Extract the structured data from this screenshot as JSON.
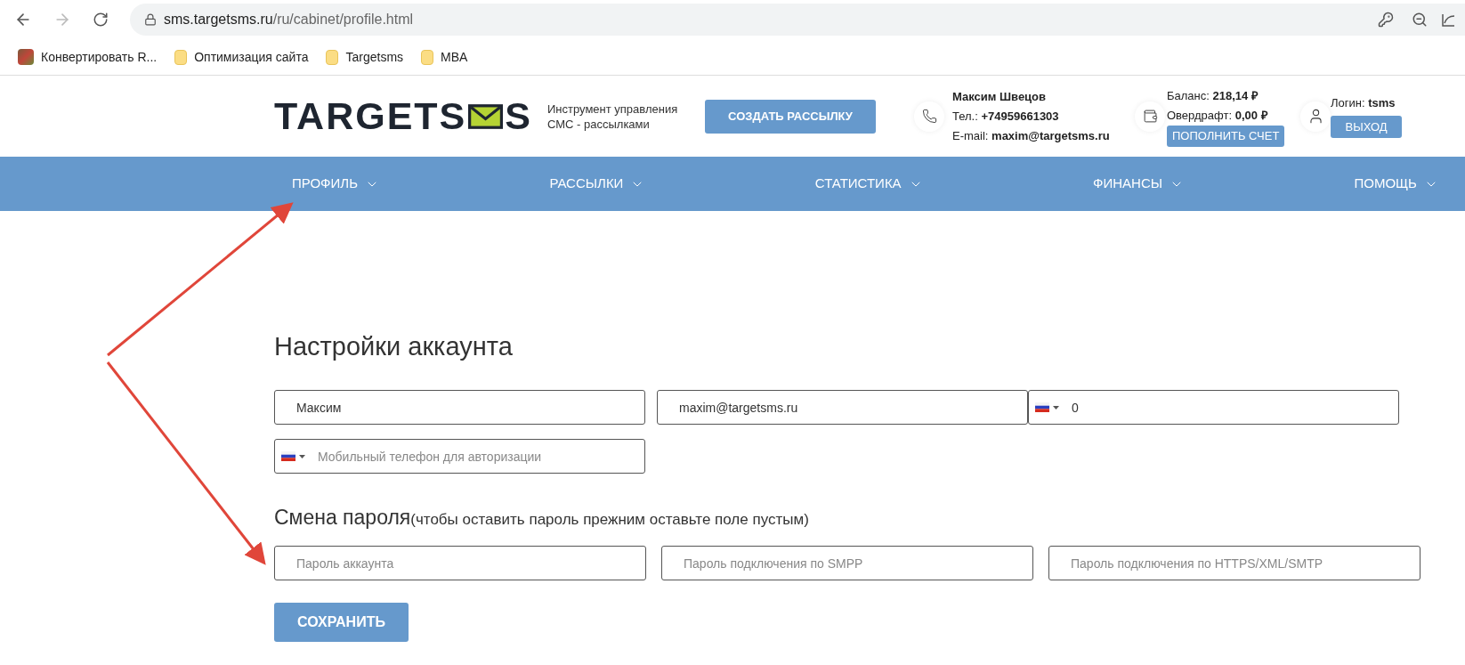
{
  "browser": {
    "url_host": "sms.targetsms.ru",
    "url_path": "/ru/cabinet/profile.html",
    "bookmarks": [
      {
        "label": "Конвертировать R...",
        "kind": "site"
      },
      {
        "label": "Оптимизация сайта",
        "kind": "folder"
      },
      {
        "label": "Targetsms",
        "kind": "folder"
      },
      {
        "label": "MBA",
        "kind": "folder"
      }
    ]
  },
  "header": {
    "logo_left": "TARGETS",
    "logo_right": "S",
    "tagline": [
      "Инструмент управления",
      "СМС - рассылками"
    ],
    "create_button": "СОЗДАТЬ РАССЫЛКУ",
    "contact": {
      "name": "Максим Швецов",
      "phone_label": "Тел.:",
      "phone": "+74959661303",
      "email_label": "E-mail:",
      "email": "maxim@targetsms.ru"
    },
    "balance": {
      "balance_label": "Баланс:",
      "balance": "218,14 ₽",
      "overdraft_label": "Овердрафт:",
      "overdraft": "0,00 ₽",
      "topup_button": "ПОПОЛНИТЬ СЧЕТ"
    },
    "account": {
      "login_label": "Логин:",
      "login": "tsms",
      "logout_button": "ВЫХОД"
    }
  },
  "nav": [
    {
      "label": "ПРОФИЛЬ"
    },
    {
      "label": "РАССЫЛКИ"
    },
    {
      "label": "СТАТИСТИКА"
    },
    {
      "label": "ФИНАНСЫ"
    },
    {
      "label": "ПОМОЩЬ"
    }
  ],
  "settings": {
    "title": "Настройки аккаунта",
    "fields": [
      {
        "kind": "text",
        "value": "Максим"
      },
      {
        "kind": "text",
        "value": "maxim@targetsms.ru"
      },
      {
        "kind": "phone",
        "value": "0"
      },
      {
        "kind": "phone",
        "placeholder": "Мобильный телефон для авторизации"
      }
    ]
  },
  "password": {
    "title": "Смена пароля",
    "hint": "(чтобы оставить пароль прежним оставьте поле пустым)",
    "fields": [
      {
        "kind": "text",
        "placeholder": "Пароль аккаунта"
      },
      {
        "kind": "text",
        "placeholder": "Пароль подключения по SMPP"
      },
      {
        "kind": "text",
        "placeholder": "Пароль подключения по HTTPS/XML/SMTP"
      }
    ]
  },
  "save_button": "СОХРАНИТЬ"
}
